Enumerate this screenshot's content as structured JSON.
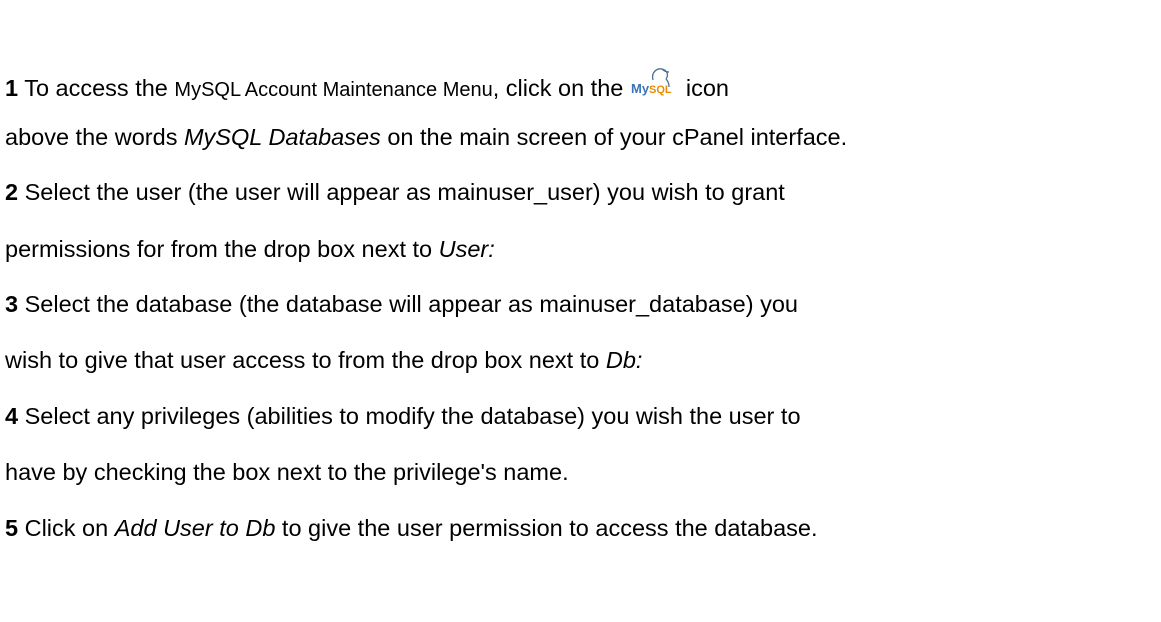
{
  "steps": [
    {
      "number": "1",
      "line1_pre": "To access the ",
      "line1_small": "MySQL Account Maintenance Menu",
      "line1_post": ", click on the",
      "icon_label": "MySQL",
      "line1_end": " icon",
      "line2_pre": "above the words ",
      "line2_em": "MySQL Databases",
      "line2_post": " on the main screen of your cPanel interface."
    },
    {
      "number": "2",
      "line1": "Select the user (the user will appear as mainuser_user) you wish to grant",
      "line2_pre": "permissions for from the drop box next to ",
      "line2_em": "User:"
    },
    {
      "number": "3",
      "line1": "Select the database (the database will appear as mainuser_database) you",
      "line2_pre": "wish to give that user access to from the drop box next to ",
      "line2_em": "Db:"
    },
    {
      "number": "4",
      "line1": "Select any privileges (abilities to modify the database) you wish the user to",
      "line2": "have by checking the box next to the privilege's name."
    },
    {
      "number": "5",
      "line1_pre": "Click on ",
      "line1_em": "Add User to Db",
      "line1_post": " to give the user permission to access the database."
    }
  ],
  "colors": {
    "logo_text": "#3b73b9",
    "logo_accent": "#e48e00"
  }
}
